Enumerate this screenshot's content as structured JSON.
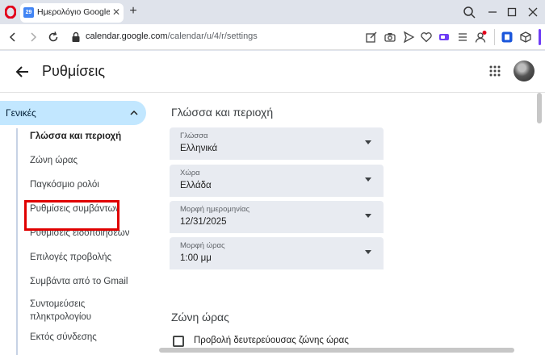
{
  "browser": {
    "tab_title": "Ημερολόγιο Google - Γενι",
    "tab_favicon_text": "29",
    "url_host": "calendar.google.com",
    "url_path": "/calendar/u/4/r/settings"
  },
  "header": {
    "title": "Ρυθμίσεις"
  },
  "sidebar": {
    "section_title": "Γενικές",
    "items": [
      {
        "label": "Γλώσσα και περιοχή"
      },
      {
        "label": "Ζώνη ώρας"
      },
      {
        "label": "Παγκόσμιο ρολόι"
      },
      {
        "label": "Ρυθμίσεις συμβάντων"
      },
      {
        "label": "Ρυθμίσεις ειδοποιήσεων"
      },
      {
        "label": "Επιλογές προβολής"
      },
      {
        "label": "Συμβάντα από το Gmail"
      },
      {
        "label": "Συντομεύσεις πληκτρολογίου"
      },
      {
        "label": "Εκτός σύνδεσης"
      }
    ]
  },
  "content": {
    "section1_title": "Γλώσσα και περιοχή",
    "selects": [
      {
        "label": "Γλώσσα",
        "value": "Ελληνικά"
      },
      {
        "label": "Χώρα",
        "value": "Ελλάδα"
      },
      {
        "label": "Μορφή ημερομηνίας",
        "value": "12/31/2025"
      },
      {
        "label": "Μορφή ώρας",
        "value": "1:00 μμ"
      }
    ],
    "section2_title": "Ζώνη ώρας",
    "secondary_tz_label": "Προβολή δευτερεύουσας ζώνης ώρας"
  },
  "colors": {
    "accent": "#c2e7ff",
    "highlight_box": "#e00000",
    "opera_red": "#e3001b",
    "extension_purple": "#6e3df5"
  }
}
